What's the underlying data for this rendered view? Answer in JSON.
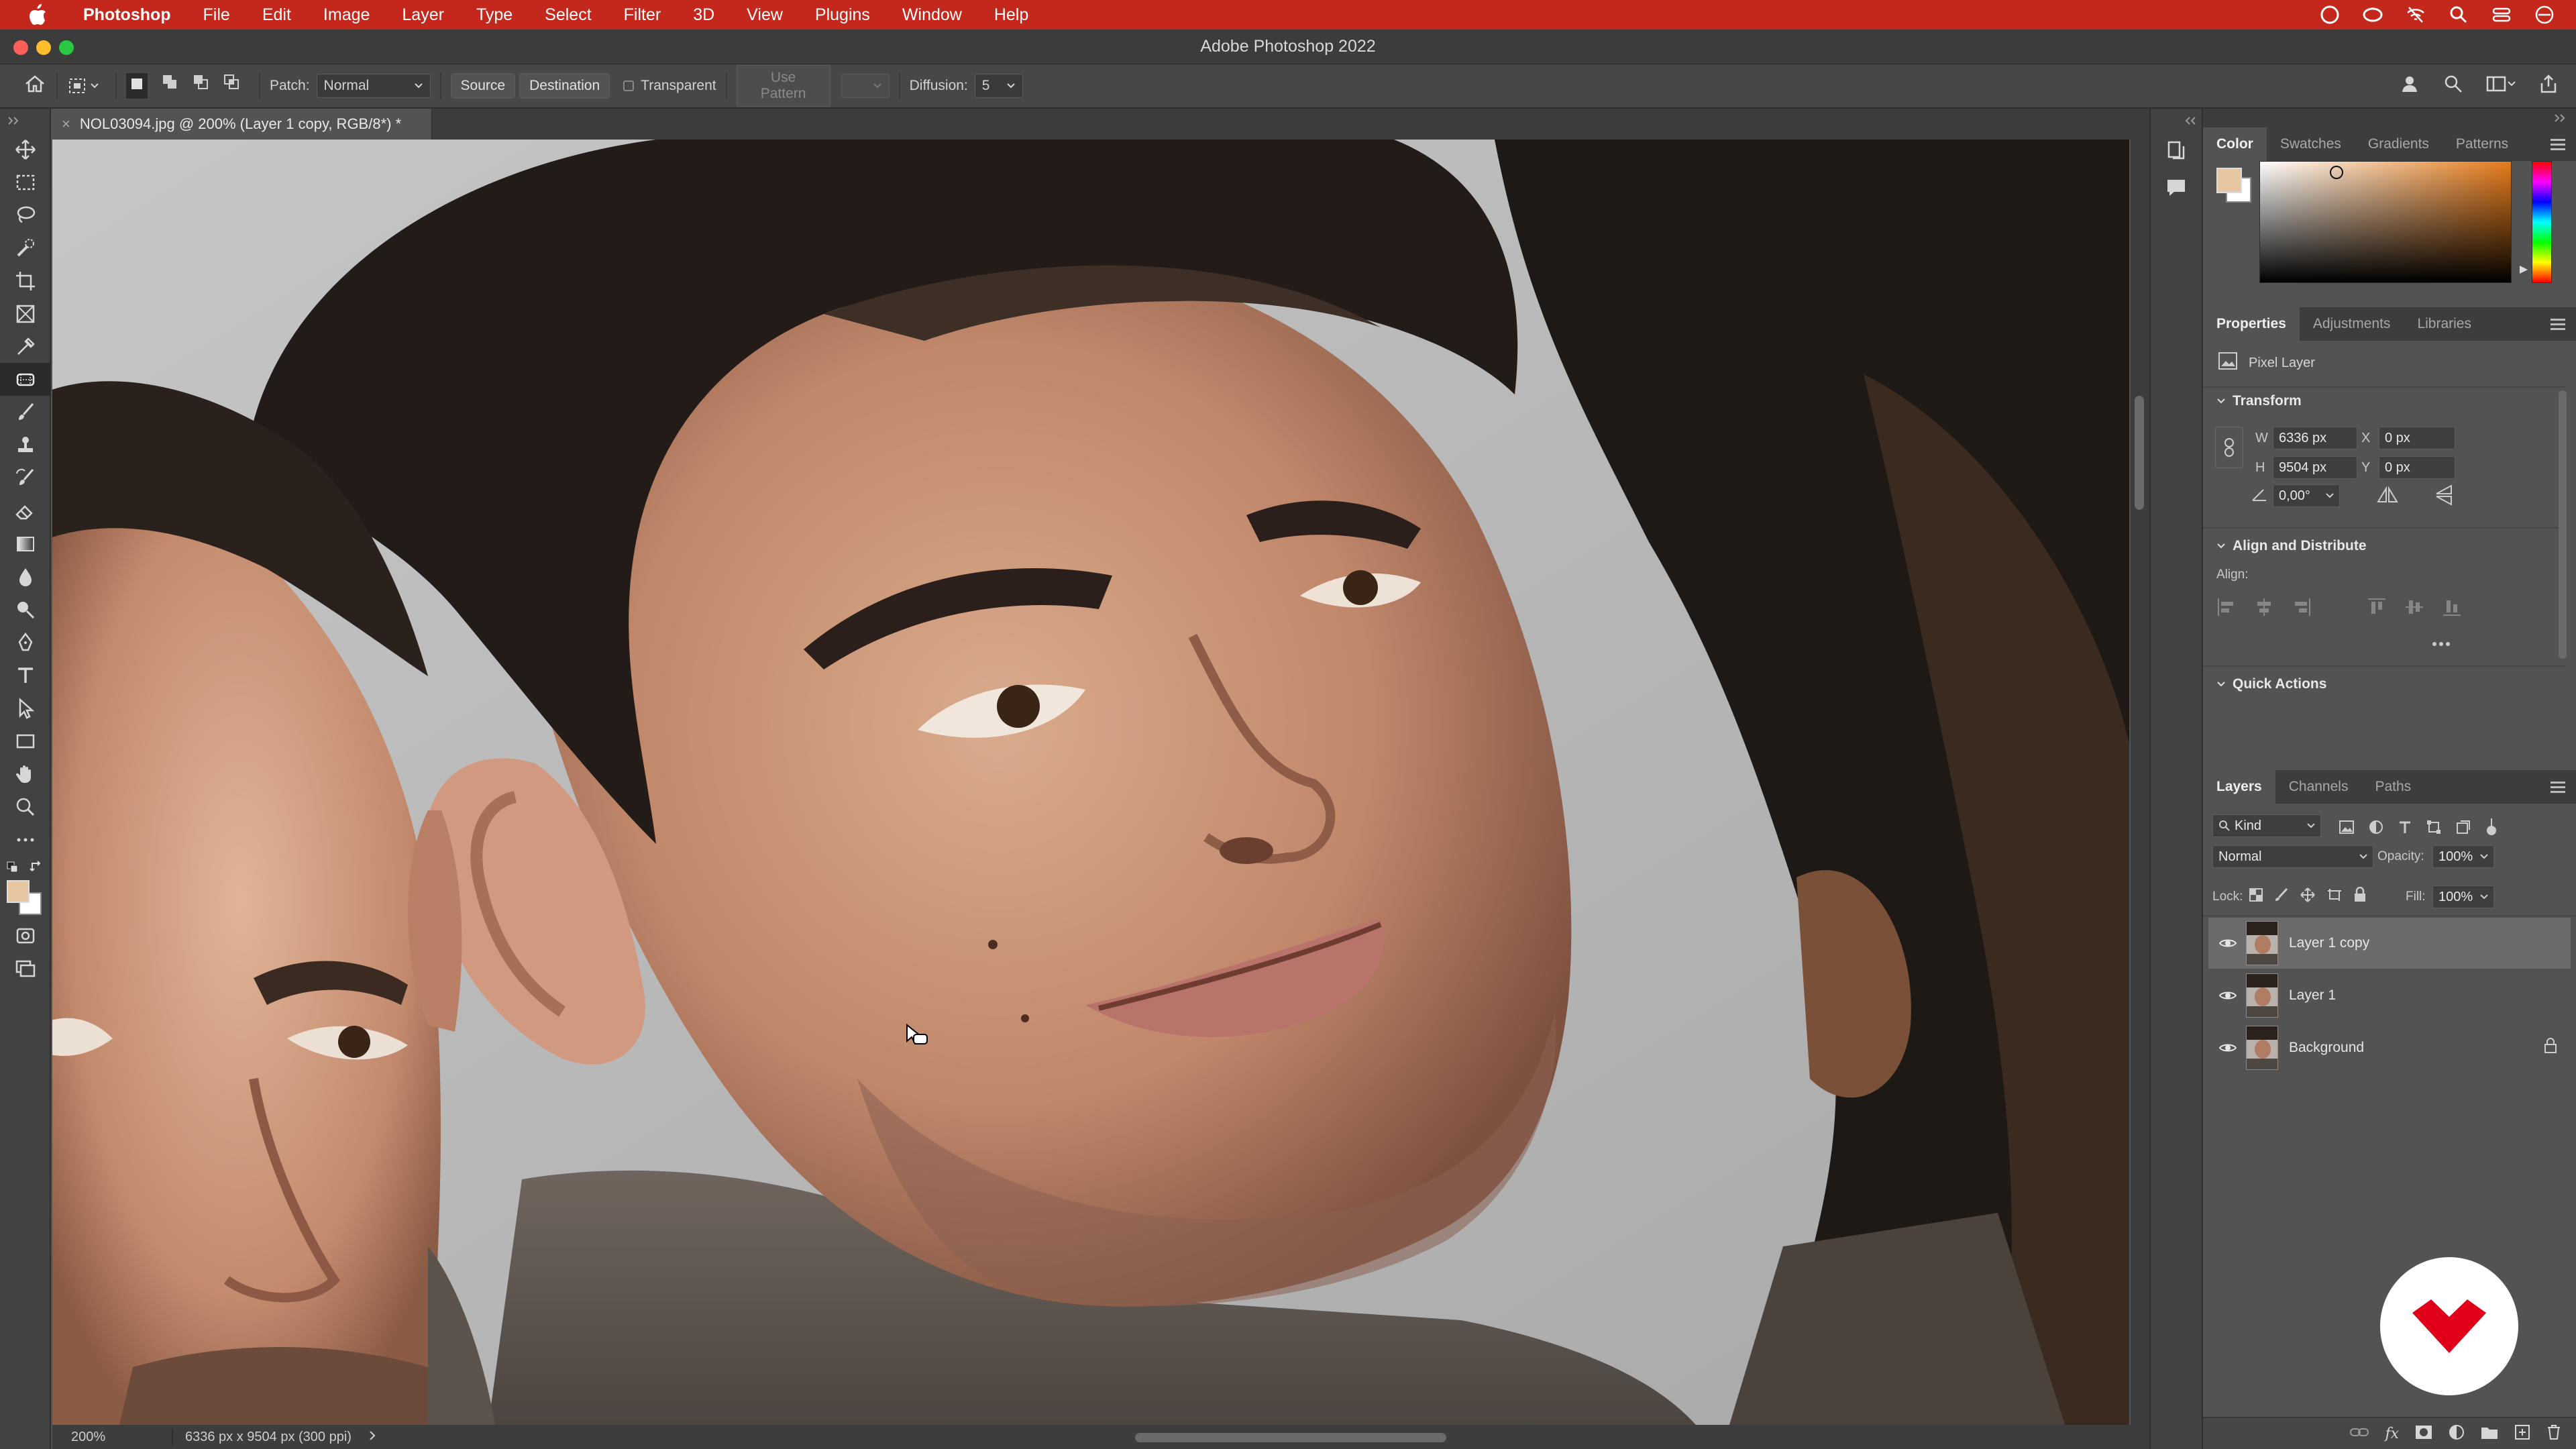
{
  "menubar": {
    "app": "Photoshop",
    "items": [
      "File",
      "Edit",
      "Image",
      "Layer",
      "Type",
      "Select",
      "Filter",
      "3D",
      "View",
      "Plugins",
      "Window",
      "Help"
    ]
  },
  "window": {
    "title": "Adobe Photoshop 2022"
  },
  "options": {
    "patch_label": "Patch:",
    "patch_mode": "Normal",
    "source": "Source",
    "destination": "Destination",
    "transparent": "Transparent",
    "use_pattern": "Use Pattern",
    "diffusion_label": "Diffusion:",
    "diffusion_value": "5"
  },
  "document": {
    "tab": "NOL03094.jpg @ 200% (Layer 1 copy, RGB/8*) *",
    "zoom": "200%",
    "info": "6336 px x 9504 px (300 ppi)"
  },
  "color_panel": {
    "tabs": [
      "Color",
      "Swatches",
      "Gradients",
      "Patterns"
    ],
    "foreground": "#e6c7a2",
    "background": "#ffffff"
  },
  "properties": {
    "tabs": [
      "Properties",
      "Adjustments",
      "Libraries"
    ],
    "kind": "Pixel Layer",
    "transform_title": "Transform",
    "w_label": "W",
    "w": "6336 px",
    "h_label": "H",
    "h": "9504 px",
    "x_label": "X",
    "x": "0 px",
    "y_label": "Y",
    "y": "0 px",
    "angle": "0,00°",
    "align_title": "Align and Distribute",
    "align_label": "Align:",
    "quick_title": "Quick Actions"
  },
  "layers_panel": {
    "tabs": [
      "Layers",
      "Channels",
      "Paths"
    ],
    "filter": "Kind",
    "blend": "Normal",
    "opacity_label": "Opacity:",
    "opacity": "100%",
    "lock_label": "Lock:",
    "fill_label": "Fill:",
    "fill": "100%",
    "layers": [
      {
        "name": "Layer 1 copy",
        "selected": true
      },
      {
        "name": "Layer 1",
        "selected": false
      },
      {
        "name": "Background",
        "selected": false,
        "locked": true
      }
    ]
  },
  "brand": {
    "logo_color": "#e1001a"
  }
}
